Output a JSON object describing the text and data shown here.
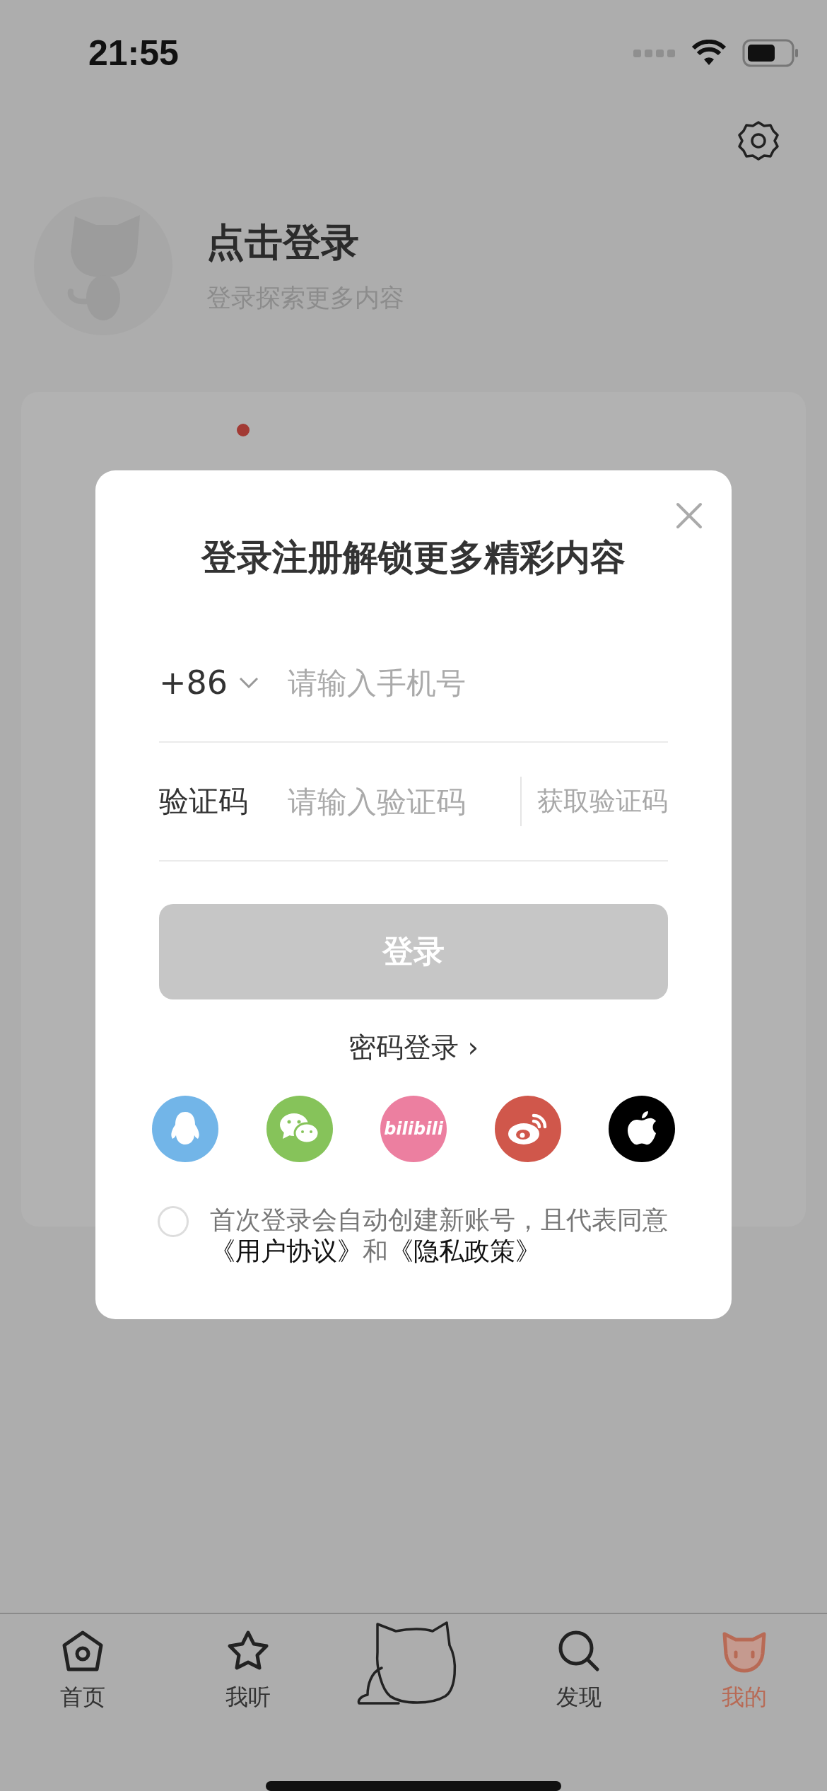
{
  "status_bar": {
    "time": "21:55"
  },
  "profile": {
    "title": "点击登录",
    "subtitle": "登录探索更多内容"
  },
  "login_dialog": {
    "title": "登录注册解锁更多精彩内容",
    "phone": {
      "country_code": "+86",
      "placeholder": "请输入手机号"
    },
    "code": {
      "label": "验证码",
      "placeholder": "请输入验证码",
      "send_button": "获取验证码"
    },
    "login_button": {
      "label": "登录",
      "disabled": true
    },
    "password_login": "密码登录",
    "password_login_chevron": "›",
    "social_logins": [
      {
        "kind": "qq",
        "color": "#72b5e8"
      },
      {
        "kind": "wechat",
        "color": "#86c35a"
      },
      {
        "kind": "bilibili",
        "color": "#ec7fa0",
        "text": "bilibili"
      },
      {
        "kind": "weibo",
        "color": "#d0574b"
      },
      {
        "kind": "apple",
        "color": "#000000"
      }
    ],
    "agreement": {
      "checked": false,
      "text": "首次登录会自动创建新账号，且代表同意",
      "links": [
        "《用户协议》",
        "《隐私政策》"
      ],
      "joiner": "和"
    }
  },
  "tab_bar": [
    {
      "kind": "home",
      "label": "首页",
      "selected": false
    },
    {
      "kind": "star",
      "label": "我听",
      "selected": false
    },
    {
      "kind": "cat",
      "selected": false
    },
    {
      "kind": "search",
      "label": "发现",
      "selected": false
    },
    {
      "kind": "profile",
      "label": "我的",
      "selected": true
    }
  ]
}
